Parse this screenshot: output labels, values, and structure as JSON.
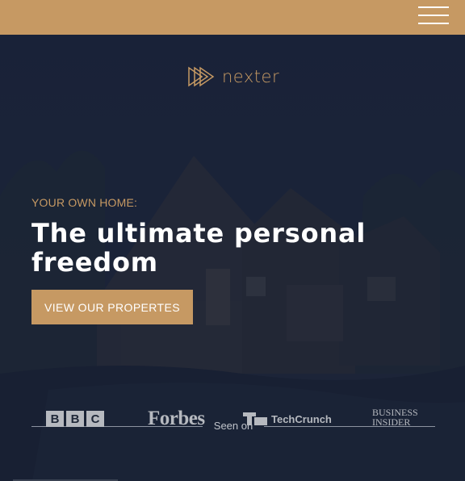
{
  "header": {
    "menu_icon": "hamburger-icon",
    "color": "#c69963"
  },
  "hero": {
    "logo_text": "nexter",
    "eyebrow": "YOUR OWN HOME:",
    "headline_line1": "The ultimate personal",
    "headline_line2": "freedom",
    "cta_label": "VIEW OUR PROPERTES",
    "seen_on": "Seen on"
  },
  "press": {
    "bbc": [
      "B",
      "B",
      "C"
    ],
    "forbes": "Forbes",
    "techcrunch": "TechCrunch",
    "business_insider_line1": "BUSINESS",
    "business_insider_line2": "INSIDER"
  },
  "colors": {
    "accent": "#c69963",
    "background": "#1c2537"
  }
}
